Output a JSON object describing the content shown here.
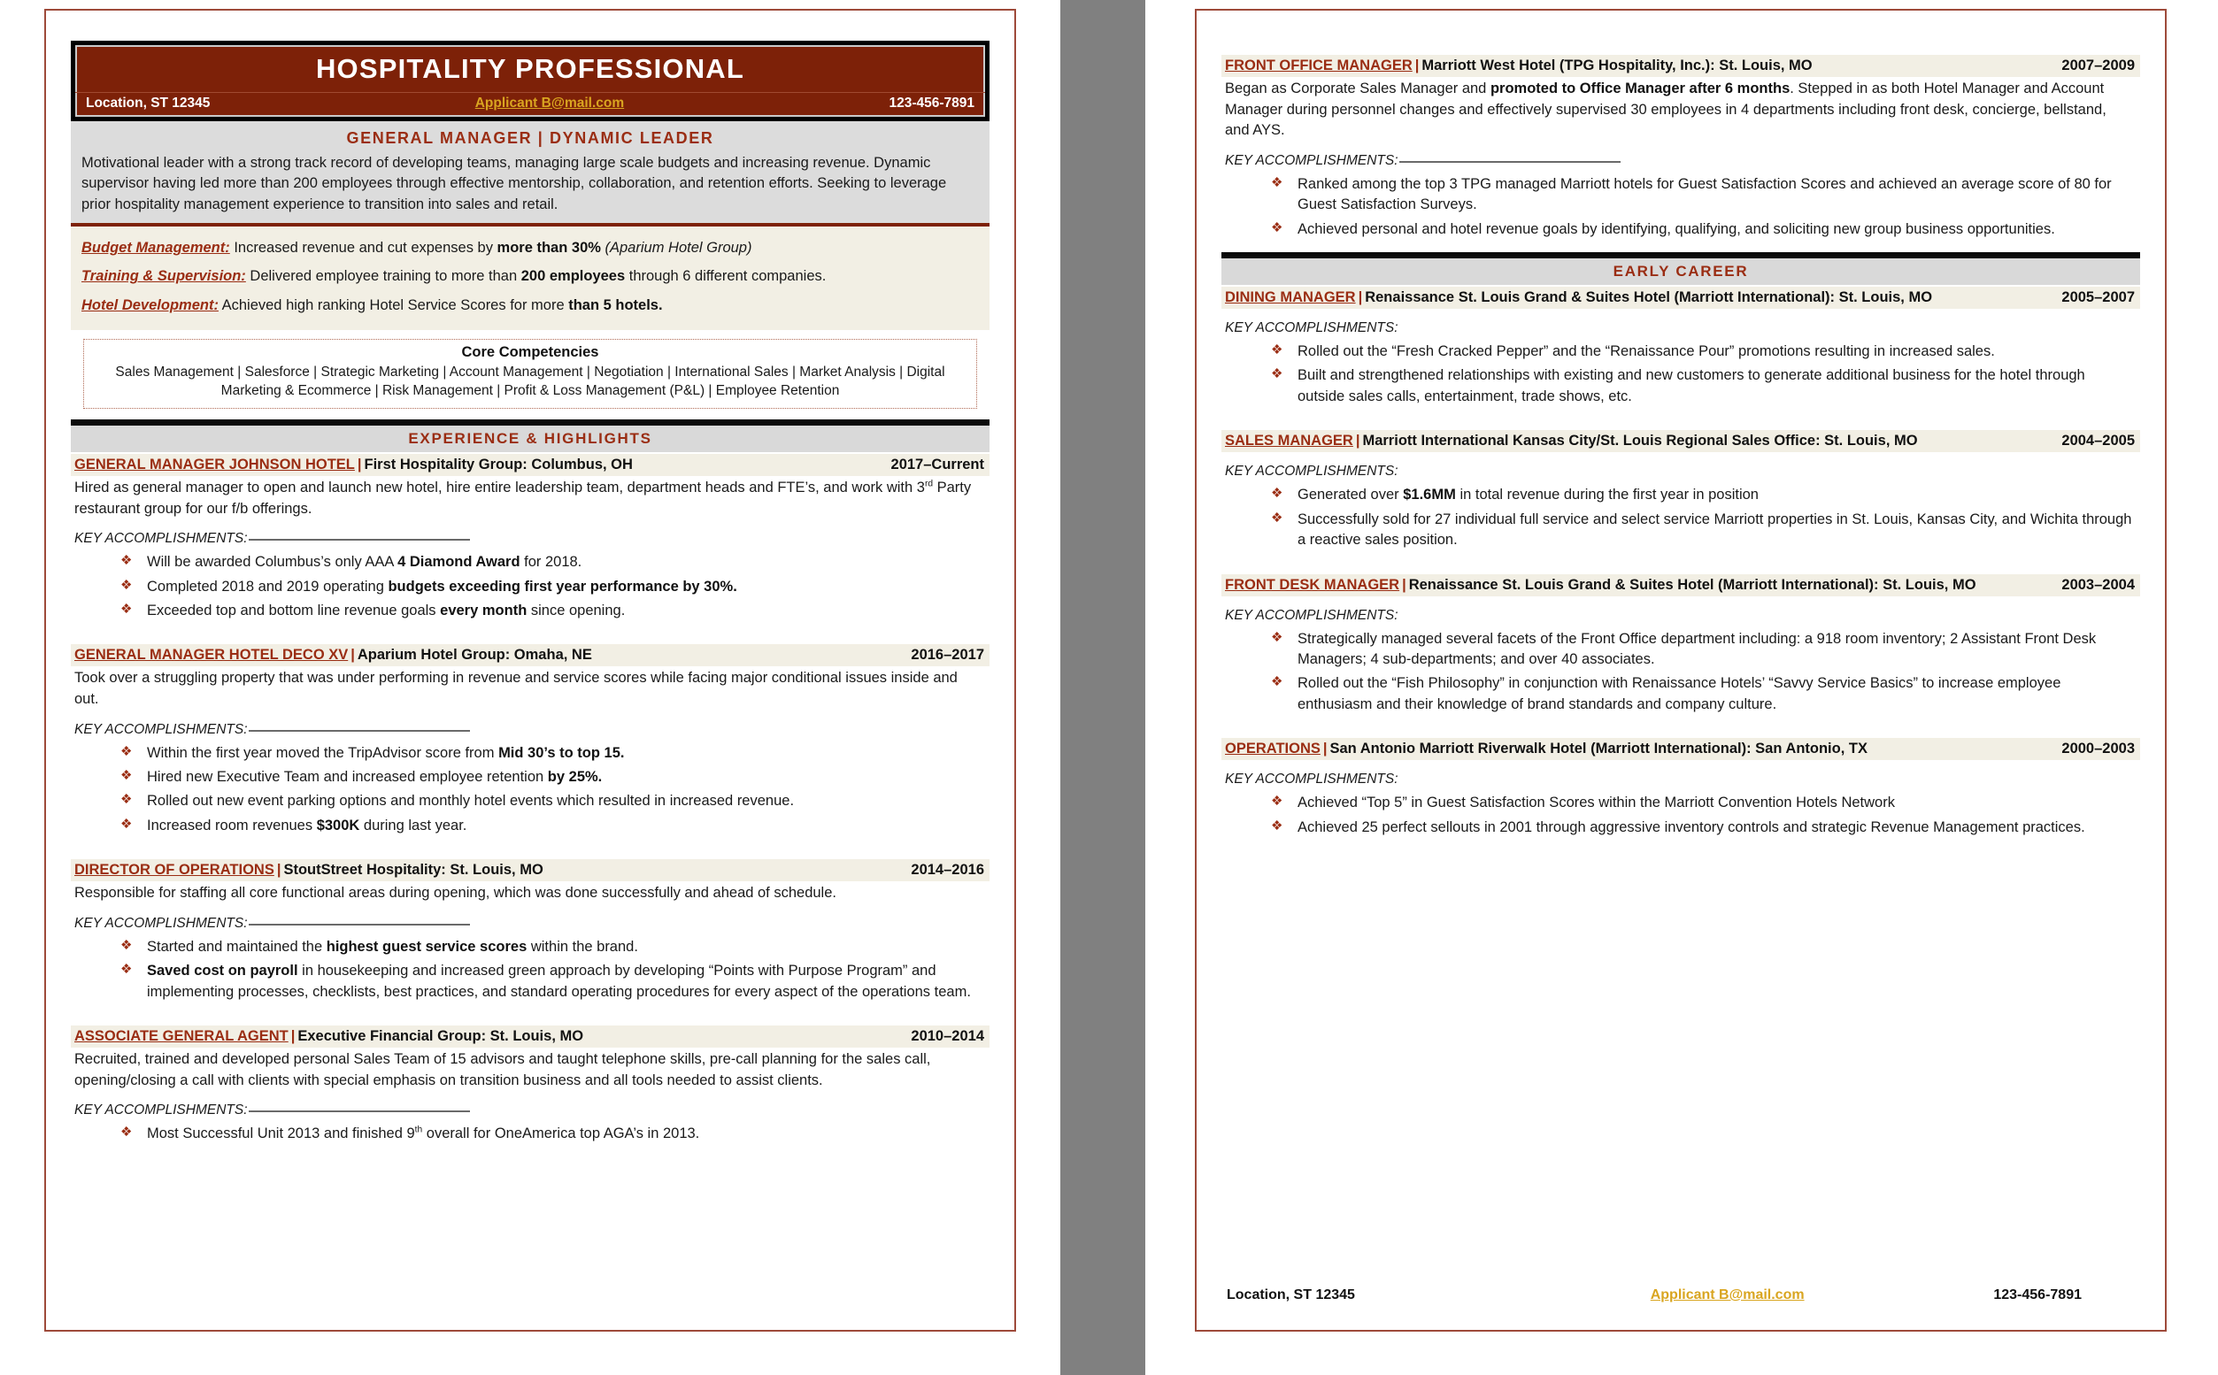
{
  "colors": {
    "brand_maroon": "#7d2108",
    "accent_red": "#9a2d13",
    "email_gold": "#d9a520",
    "band_gray": "#d9d9d9",
    "cream": "#f2efe4",
    "gutter_gray": "#808080"
  },
  "header": {
    "name": "HOSPITALITY PROFESSIONAL",
    "location": "Location, ST 12345",
    "email": "Applicant B@mail.com",
    "phone": "123-456-7891"
  },
  "summary": {
    "title": "GENERAL MANAGER | DYNAMIC LEADER",
    "text": "Motivational leader with a strong track record of developing teams, managing large scale budgets and increasing revenue. Dynamic supervisor having led more than 200 employees through effective mentorship, collaboration, and retention efforts. Seeking to leverage prior hospitality management experience to transition into sales and retail."
  },
  "highlights": [
    {
      "label": "Budget Management:",
      "text_before": " Increased revenue and cut expenses by ",
      "bold": "more than 30%",
      "italic_after": " (Aparium Hotel Group)",
      "text_after": ""
    },
    {
      "label": "Training & Supervision:",
      "text_before": " Delivered employee training to more than ",
      "bold": "200 employees",
      "italic_after": "",
      "text_after": " through 6 different companies."
    },
    {
      "label": "Hotel Development:",
      "text_before": " Achieved high ranking Hotel Service Scores for more ",
      "bold": "than 5 hotels.",
      "italic_after": "",
      "text_after": ""
    }
  ],
  "core_competencies": {
    "title": "Core Competencies",
    "list": "Sales Management | Salesforce | Strategic Marketing | Account Management | Negotiation | International Sales | Market Analysis | Digital Marketing & Ecommerce | Risk Management | Profit & Loss Management (P&L) | Employee Retention"
  },
  "sections": {
    "experience": "EXPERIENCE & HIGHLIGHTS",
    "early_career": "EARLY CAREER"
  },
  "labels": {
    "key_accomplishments": "KEY ACCOMPLISHMENTS:"
  },
  "jobs_page1": [
    {
      "title": "GENERAL MANAGER JOHNSON HOTEL",
      "sep": "|",
      "company": "First Hospitality Group: Columbus, OH",
      "dates": "2017–Current",
      "desc_parts": [
        {
          "t": "Hired as general manager to open and launch new hotel, hire entire leadership team, department heads and FTE’s, and work with 3"
        },
        {
          "sup": "rd"
        },
        {
          "t": " Party restaurant group for our f/b offerings."
        }
      ],
      "bullets": [
        [
          {
            "t": "Will be awarded Columbus’s only AAA "
          },
          {
            "b": "4 Diamond Award"
          },
          {
            "t": " for 2018."
          }
        ],
        [
          {
            "t": "Completed 2018 and 2019 operating "
          },
          {
            "b": "budgets exceeding first year performance by 30%."
          }
        ],
        [
          {
            "t": "Exceeded top and bottom line revenue goals "
          },
          {
            "b": "every month"
          },
          {
            "t": " since opening."
          }
        ]
      ]
    },
    {
      "title": "GENERAL MANAGER HOTEL DECO XV",
      "sep": "|",
      "company": "Aparium Hotel Group: Omaha, NE",
      "dates": "2016–2017",
      "desc_parts": [
        {
          "t": "Took over a struggling property that was under performing in revenue and service scores while facing major conditional issues inside and out."
        }
      ],
      "bullets": [
        [
          {
            "t": "Within the first year moved the TripAdvisor score from "
          },
          {
            "b": "Mid 30’s to top 15."
          }
        ],
        [
          {
            "t": "Hired new Executive Team and increased employee retention "
          },
          {
            "b": "by 25%."
          }
        ],
        [
          {
            "t": "Rolled out new event parking options and monthly hotel events which resulted in increased revenue."
          }
        ],
        [
          {
            "t": "Increased room revenues "
          },
          {
            "b": "$300K"
          },
          {
            "t": " during last year."
          }
        ]
      ]
    },
    {
      "title": "DIRECTOR OF OPERATIONS",
      "sep": "|",
      "company": "StoutStreet Hospitality: St. Louis, MO",
      "dates": "2014–2016",
      "desc_parts": [
        {
          "t": "Responsible for staffing all core functional areas during opening, which was done successfully and ahead of schedule."
        }
      ],
      "bullets": [
        [
          {
            "t": "Started and maintained the "
          },
          {
            "b": "highest guest service scores"
          },
          {
            "t": " within the brand."
          }
        ],
        [
          {
            "b": "Saved cost on payroll"
          },
          {
            "t": " in housekeeping and increased green approach by developing “Points with Purpose Program” and implementing processes, checklists, best practices, and standard operating procedures for every aspect of the operations team."
          }
        ]
      ]
    },
    {
      "title": "ASSOCIATE GENERAL AGENT",
      "sep": "|",
      "company": "Executive Financial Group: St. Louis, MO",
      "dates": "2010–2014",
      "desc_parts": [
        {
          "t": "Recruited, trained and developed personal Sales Team of 15 advisors and taught telephone skills, pre-call planning for the sales call, opening/closing a call with clients with special emphasis on transition business and all tools needed to assist clients."
        }
      ],
      "bullets": [
        [
          {
            "t": "Most Successful Unit 2013 and finished 9"
          },
          {
            "sup": "th"
          },
          {
            "t": " overall for OneAmerica top AGA’s in 2013."
          }
        ]
      ]
    }
  ],
  "jobs_page2_top": [
    {
      "title": "FRONT OFFICE MANAGER",
      "sep": "|",
      "company": "Marriott West Hotel (TPG Hospitality, Inc.): St. Louis, MO",
      "dates": "2007–2009",
      "desc_parts": [
        {
          "t": "Began as Corporate Sales Manager and "
        },
        {
          "b": "promoted to Office Manager after 6 months"
        },
        {
          "t": ". Stepped in as both Hotel Manager and Account Manager during personnel changes and effectively supervised 30 employees in 4 departments including front desk, concierge, bellstand, and AYS."
        }
      ],
      "bullets": [
        [
          {
            "t": "Ranked among the top 3 TPG managed Marriott hotels for Guest Satisfaction Scores and achieved an average score of 80 for Guest Satisfaction Surveys."
          }
        ],
        [
          {
            "t": "Achieved personal and hotel revenue goals by identifying, qualifying, and soliciting new group business opportunities."
          }
        ]
      ]
    }
  ],
  "jobs_early_career": [
    {
      "title": "DINING MANAGER",
      "sep": "|",
      "company": "Renaissance St. Louis Grand & Suites Hotel (Marriott International): St. Louis, MO",
      "dates": "2005–2007",
      "tight": true,
      "desc_parts": [],
      "bullets": [
        [
          {
            "t": "Rolled out the “Fresh Cracked Pepper” and the “Renaissance Pour” promotions resulting in increased sales."
          }
        ],
        [
          {
            "t": "Built and strengthened relationships with existing and new customers to generate additional business for the hotel through outside sales calls, entertainment, trade shows, etc."
          }
        ]
      ]
    },
    {
      "title": "SALES MANAGER",
      "sep": "|",
      "company": "Marriott International Kansas City/St. Louis Regional Sales Office: St. Louis, MO",
      "dates": "2004–2005",
      "desc_parts": [],
      "bullets": [
        [
          {
            "t": "Generated over "
          },
          {
            "b": "$1.6MM"
          },
          {
            "t": " in total revenue during the first year in position"
          }
        ],
        [
          {
            "t": "Successfully sold for 27 individual full service and select service Marriott properties in St. Louis, Kansas City, and Wichita through a reactive sales position."
          }
        ]
      ]
    },
    {
      "title": "FRONT DESK MANAGER",
      "sep": "|",
      "company": "Renaissance St. Louis Grand & Suites Hotel (Marriott International): St. Louis, MO",
      "dates": "2003–2004",
      "desc_parts": [],
      "bullets": [
        [
          {
            "t": "Strategically managed several facets of the Front Office department including: a 918 room inventory; 2 Assistant Front Desk Managers; 4 sub-departments; and over 40 associates."
          }
        ],
        [
          {
            "t": "Rolled out the “Fish Philosophy” in conjunction with Renaissance Hotels’ “Savvy Service Basics” to increase employee enthusiasm and their knowledge of brand standards and company culture."
          }
        ]
      ]
    },
    {
      "title": "OPERATIONS",
      "sep": "|",
      "company": "San Antonio Marriott Riverwalk Hotel (Marriott International): San Antonio, TX",
      "dates": "2000–2003",
      "desc_parts": [],
      "bullets": [
        [
          {
            "t": "Achieved “Top 5” in Guest Satisfaction Scores within the Marriott Convention Hotels Network"
          }
        ],
        [
          {
            "t": "Achieved 25 perfect sellouts in 2001 through aggressive inventory controls and strategic Revenue Management practices."
          }
        ]
      ]
    }
  ],
  "page2_footer": {
    "location": "Location, ST 12345",
    "email": "Applicant B@mail.com",
    "phone": "123-456-7891"
  }
}
